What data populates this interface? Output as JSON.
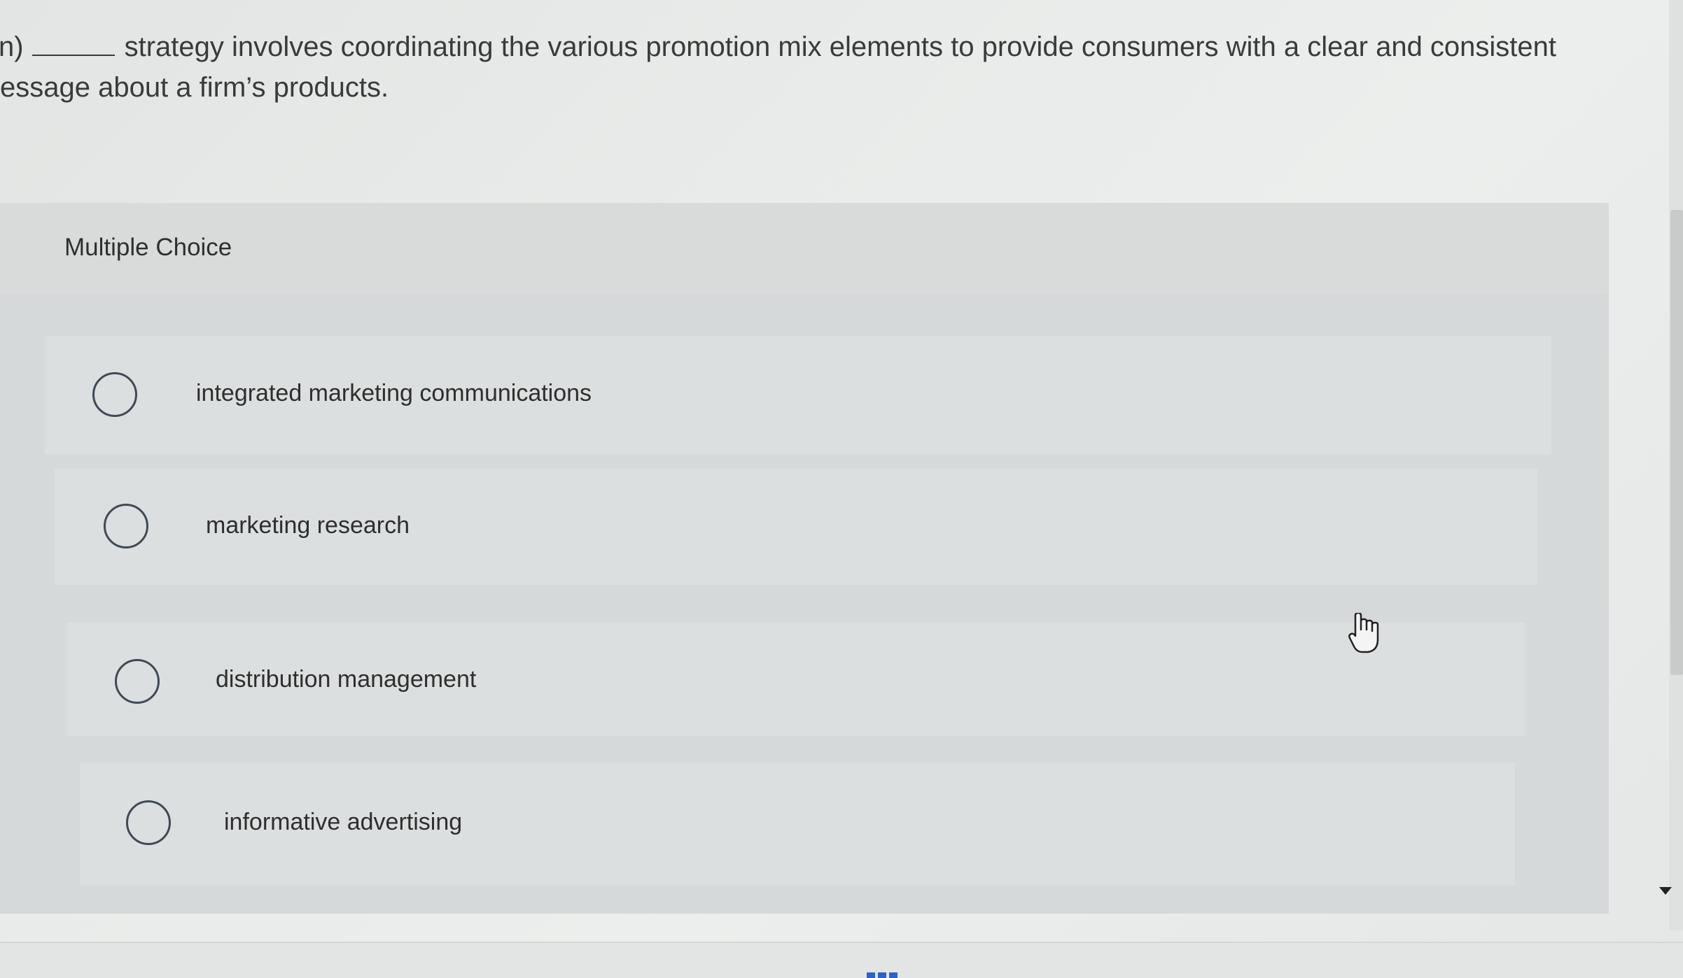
{
  "question": {
    "prefix": "n)",
    "line1": "strategy involves coordinating the various promotion mix elements to provide consumers with a clear and consistent",
    "line2": "essage about a firm’s products."
  },
  "card": {
    "label": "Multiple Choice"
  },
  "choices": [
    {
      "label": "integrated marketing communications",
      "selected": false
    },
    {
      "label": "marketing research",
      "selected": false
    },
    {
      "label": "distribution management",
      "selected": false
    },
    {
      "label": "informative advertising",
      "selected": false
    }
  ],
  "icons": {
    "cursor": "hand-pointer-icon",
    "scroll_down": "triangle-down-icon",
    "pager": "more-dots-icon"
  },
  "colors": {
    "radio_border": "#3f4a55",
    "pager_accent": "#2b62c9"
  }
}
